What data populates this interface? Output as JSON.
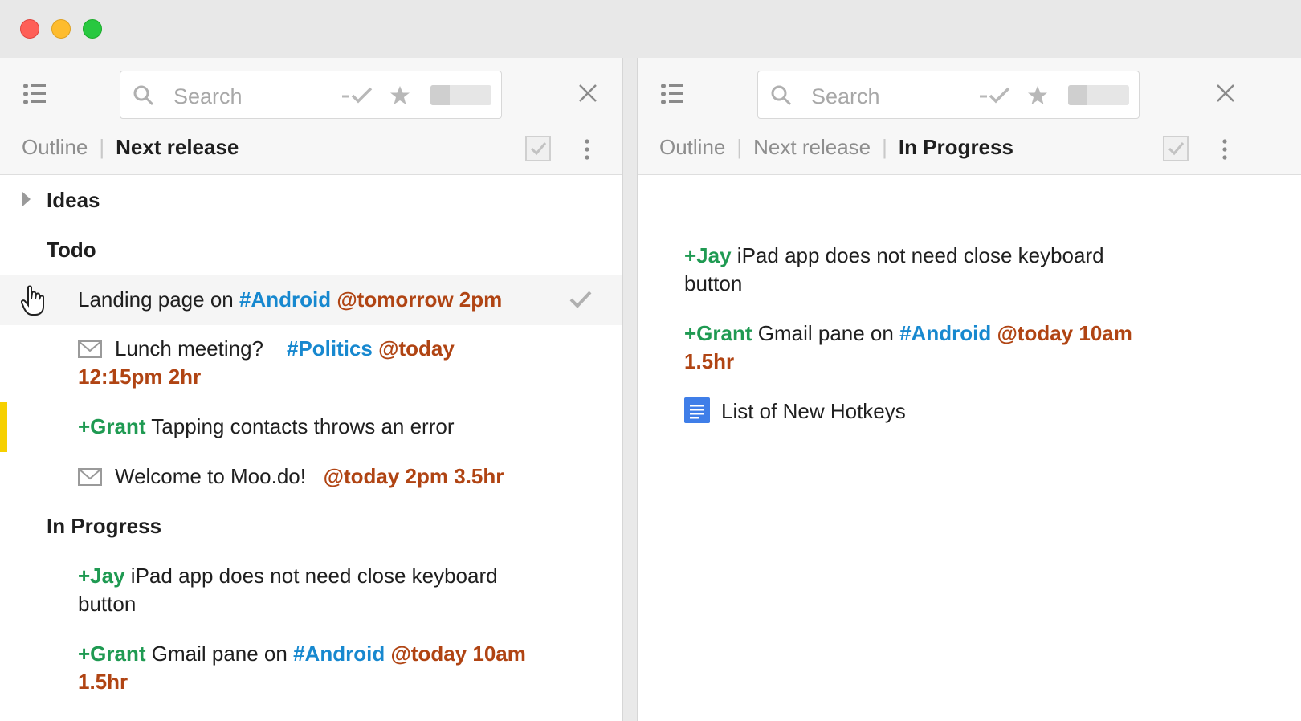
{
  "left_pane": {
    "search": {
      "placeholder": "Search"
    },
    "breadcrumb": [
      "Outline",
      "Next release"
    ],
    "rows": {
      "ideas": "Ideas",
      "todo": "Todo",
      "landing": {
        "text": "Landing page on ",
        "hash": "#Android",
        "date": "@tomorrow 2pm"
      },
      "lunch": {
        "text": "Lunch meeting?",
        "hash": "#Politics",
        "date1": "@today",
        "date2": "12:15pm 2hr"
      },
      "grant": {
        "person": "+Grant",
        "text": " Tapping contacts throws an error"
      },
      "welcome": {
        "text": "Welcome to Moo.do!",
        "date": "@today 2pm 3.5hr"
      },
      "in_progress": "In Progress",
      "jay": {
        "person": "+Jay",
        "text1": " iPad app does not need close keyboard",
        "text2": "button"
      },
      "gmail": {
        "person": "+Grant",
        "text": " Gmail pane on ",
        "hash": "#Android",
        "date1": "@today 10am",
        "date2": "1.5hr"
      }
    }
  },
  "right_pane": {
    "search": {
      "placeholder": "Search"
    },
    "breadcrumb": [
      "Outline",
      "Next release",
      "In Progress"
    ],
    "rows": {
      "jay": {
        "person": "+Jay",
        "text1": " iPad app does not need close keyboard",
        "text2": "button"
      },
      "gmail": {
        "person": "+Grant",
        "text": " Gmail pane on ",
        "hash": "#Android",
        "date1": "@today 10am",
        "date2": "1.5hr"
      },
      "hotkeys": {
        "text": "List of New Hotkeys"
      }
    }
  },
  "colors": {
    "person_tag": "#1f9a52",
    "hash_tag": "#1788cf",
    "date_tag": "#b04413",
    "priority_bar": "#f6d000"
  },
  "icons": [
    "menu-icon",
    "search-icon",
    "done-filter-icon",
    "star-icon",
    "close-icon",
    "checkbox-icon",
    "more-icon",
    "mail-icon",
    "document-icon",
    "hand-cursor-icon",
    "check-icon"
  ]
}
